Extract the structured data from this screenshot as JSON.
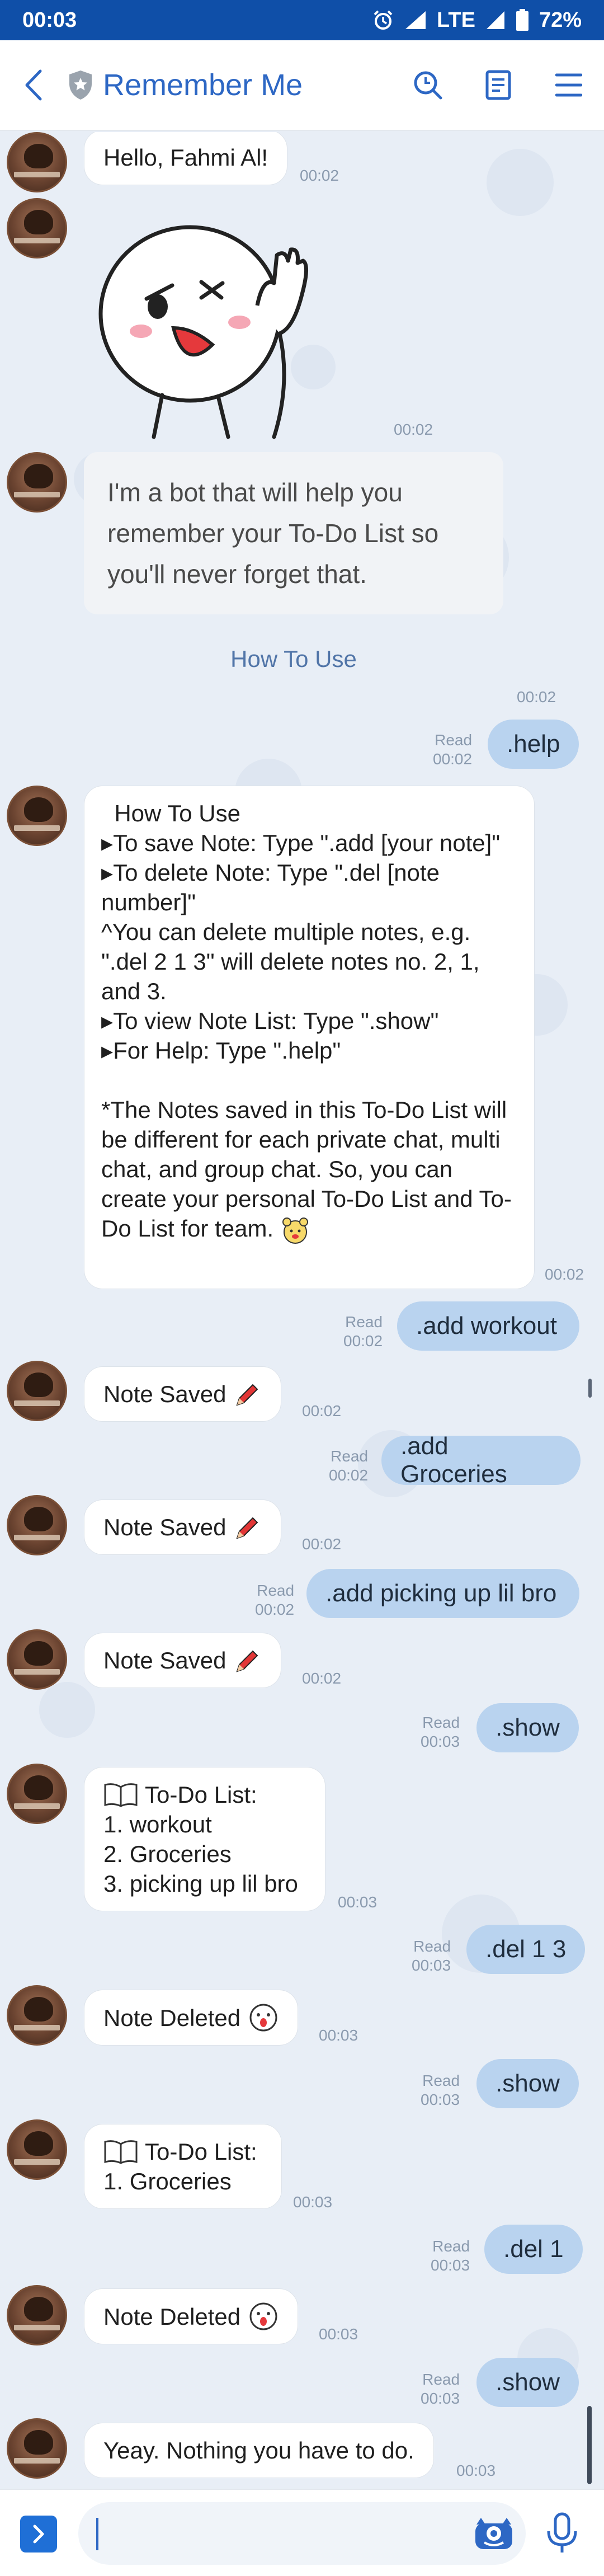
{
  "status": {
    "time": "00:03",
    "network": "LTE",
    "battery": "72%"
  },
  "header": {
    "title": "Remember Me"
  },
  "chat": {
    "greeting": "Hello, Fahmi Al!",
    "greeting_time": "00:02",
    "sticker_time": "00:02",
    "intro": "I'm a bot that will help you remember your To-Do List so you'll never forget that.",
    "howto_link": "How To Use",
    "howto_time": "00:02",
    "msg_help": {
      "text": ".help",
      "read": "Read",
      "time": "00:02"
    },
    "help_lines": [
      "  How To Use",
      "▸To save Note: Type \".add [your note]\"",
      "▸To delete Note: Type \".del [note number]\"",
      "^You can delete multiple notes, e.g. \".del 2 1 3\" will delete notes no. 2, 1, and 3.",
      "▸To view Note List: Type \".show\"",
      "▸For Help: Type \".help\"",
      "",
      "*The Notes saved in this To-Do List will be different for each private chat, multi chat, and group chat. So, you can create your personal To-Do List and To-Do List for team."
    ],
    "help_time": "00:02",
    "msg_add1": {
      "text": ".add workout",
      "read": "Read",
      "time": "00:02"
    },
    "saved1": {
      "text": "Note Saved",
      "time": "00:02"
    },
    "msg_add2": {
      "text": ".add Groceries",
      "read": "Read",
      "time": "00:02"
    },
    "saved2": {
      "text": "Note Saved",
      "time": "00:02"
    },
    "msg_add3": {
      "text": ".add picking up lil bro",
      "read": "Read",
      "time": "00:02"
    },
    "saved3": {
      "text": "Note Saved",
      "time": "00:02"
    },
    "msg_show1": {
      "text": ".show",
      "read": "Read",
      "time": "00:03"
    },
    "list1": {
      "title": "To-Do List:",
      "items": [
        "1. workout",
        "2. Groceries",
        "3. picking up lil bro"
      ],
      "time": "00:03"
    },
    "msg_del1": {
      "text": ".del 1 3",
      "read": "Read",
      "time": "00:03"
    },
    "deleted1": {
      "text": "Note Deleted",
      "time": "00:03"
    },
    "msg_show2": {
      "text": ".show",
      "read": "Read",
      "time": "00:03"
    },
    "list2": {
      "title": "To-Do List:",
      "items": [
        "1. Groceries"
      ],
      "time": "00:03"
    },
    "msg_del2": {
      "text": ".del 1",
      "read": "Read",
      "time": "00:03"
    },
    "deleted2": {
      "text": "Note Deleted",
      "time": "00:03"
    },
    "msg_show3": {
      "text": ".show",
      "read": "Read",
      "time": "00:03"
    },
    "empty": {
      "text": "Yeay. Nothing you have to do.",
      "time": "00:03"
    }
  },
  "colors": {
    "brand": "#0f4fa8",
    "title": "#2d67c4",
    "bubble_out": "#b9d3ef",
    "background": "#e8eef6"
  },
  "icons": [
    "back-icon",
    "shield-icon",
    "search-icon",
    "notes-icon",
    "menu-icon",
    "pencil-icon",
    "book-icon",
    "expand-icon",
    "emoji-icon",
    "mic-icon"
  ]
}
